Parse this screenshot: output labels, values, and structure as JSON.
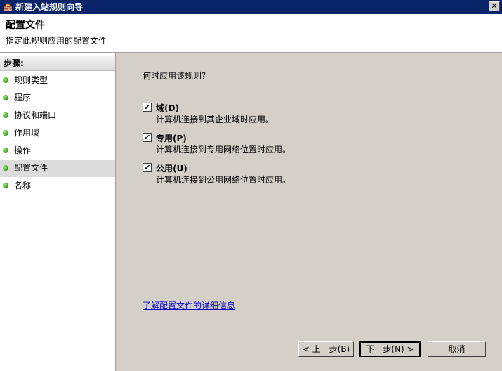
{
  "window": {
    "title": "新建入站规则向导",
    "close_label": "✕"
  },
  "header": {
    "title": "配置文件",
    "subtitle": "指定此规则应用的配置文件"
  },
  "sidebar": {
    "header": "步骤:",
    "items": [
      {
        "label": "规则类型"
      },
      {
        "label": "程序"
      },
      {
        "label": "协议和端口"
      },
      {
        "label": "作用域"
      },
      {
        "label": "操作"
      },
      {
        "label": "配置文件",
        "selected": true
      },
      {
        "label": "名称"
      }
    ]
  },
  "content": {
    "question": "何时应用该规则?",
    "options": [
      {
        "label": "域(D)",
        "description": "计算机连接到其企业域时应用。",
        "checked": true
      },
      {
        "label": "专用(P)",
        "description": "计算机连接到专用网络位置时应用。",
        "checked": true
      },
      {
        "label": "公用(U)",
        "description": "计算机连接到公用网络位置时应用。",
        "checked": true
      }
    ],
    "learn_more": "了解配置文件的详细信息"
  },
  "buttons": {
    "back": "< 上一步(B)",
    "next": "下一步(N) >",
    "cancel": "取消"
  },
  "check_glyph": "✔"
}
